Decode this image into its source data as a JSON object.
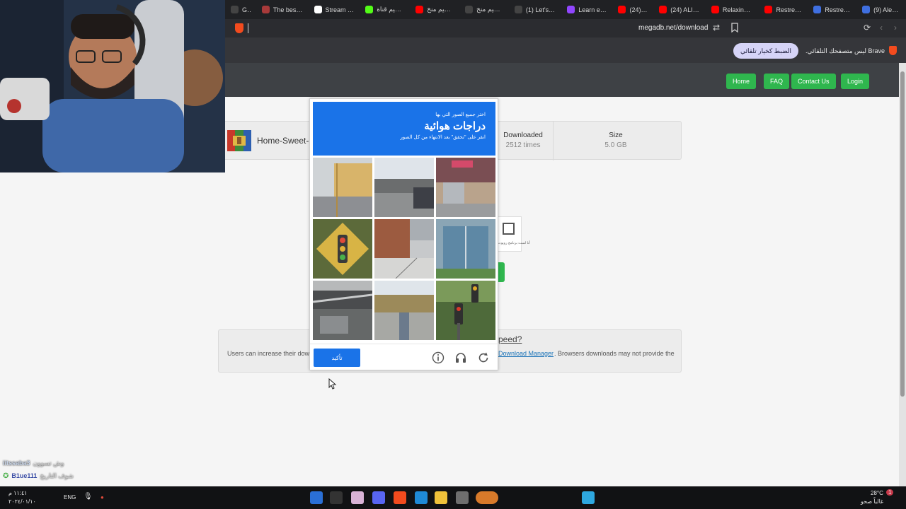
{
  "tabs": [
    {
      "label": "GE",
      "fav_color": "#444"
    },
    {
      "label": "The best C",
      "fav_color": "#a83a3a"
    },
    {
      "label": "Stream - K",
      "fav_color": "#ffffff"
    },
    {
      "label": "تصميم قناة",
      "fav_color": "#53fc18"
    },
    {
      "label": "تصميم منخ",
      "fav_color": "#ff0000"
    },
    {
      "label": "تصميم منخ",
      "fav_color": "#444"
    },
    {
      "label": "(1) Let's ha",
      "fav_color": "#444"
    },
    {
      "label": "Learn engl",
      "fav_color": "#9146ff"
    },
    {
      "label": "(24) Gi",
      "fav_color": "#ff0000"
    },
    {
      "label": "(24) ALIEN",
      "fav_color": "#ff0000"
    },
    {
      "label": "Relaxing W",
      "fav_color": "#ff0000"
    },
    {
      "label": "Restream",
      "fav_color": "#ff0000"
    },
    {
      "label": "Restream",
      "fav_color": "#3f6fe0"
    },
    {
      "label": "(9) Alert B",
      "fav_color": "#3f6fe0"
    }
  ],
  "address": {
    "url": "megadb.net/download",
    "shield_count": "4"
  },
  "notice": {
    "text": "Brave ليس متصفحك التلقائي.",
    "button": "الضبط كخيار تلقائي"
  },
  "nav": {
    "home": "Home",
    "faq": "FAQ",
    "contact": "Contact Us",
    "login": "Login"
  },
  "file": {
    "name": "Home-Sweet-",
    "downloaded_label": "Downloaded",
    "downloaded_value": "2512 times",
    "size_label": "Size",
    "size_value": "5.0 GB"
  },
  "recaptcha": {
    "text": "أنا لست برنامج روبوت"
  },
  "speed": {
    "title": "peed?",
    "left_text": "Users can increase their dow",
    "link": "Download Manager",
    "right_text": ". Browsers downloads may not provide the"
  },
  "captcha": {
    "instruction": "اختر جميع الصور التي بها",
    "target": "دراجات هوائية",
    "hint": "انقر على \"تحقق\" بعد الانتهاء من كل الصور",
    "verify": "تأكيد",
    "tiles": [
      "building-wood",
      "street-road",
      "storefront",
      "traffic-sign",
      "sidewalk-building",
      "glass-building",
      "balcony",
      "field-road",
      "traffic-light"
    ]
  },
  "chat": [
    {
      "user": "iitssaba3",
      "msg": "وش تسوون"
    },
    {
      "user": "B1ue111",
      "msg": "شوف التاريخ"
    }
  ],
  "taskbar": {
    "time": "١١:٤١",
    "period": "م",
    "date": "٢٠٢٤/٠١/١٠",
    "lang": "ENG",
    "weather": "28°C",
    "weather_desc": "غالباً صحو",
    "notification_count": "1"
  }
}
